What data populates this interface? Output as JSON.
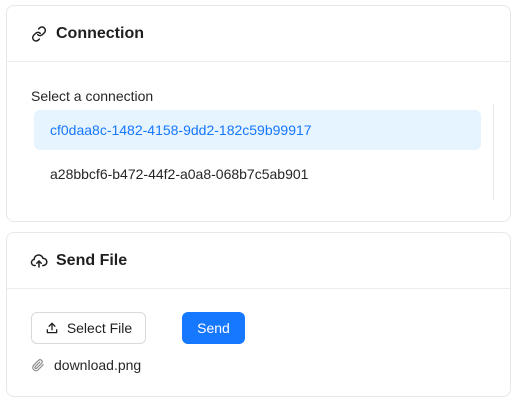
{
  "connection_card": {
    "title": "Connection",
    "title_icon": "link-icon",
    "select_label": "Select a connection",
    "connections": [
      {
        "id": "cf0daa8c-1482-4158-9dd2-182c59b99917",
        "selected": true
      },
      {
        "id": "a28bbcf6-b472-44f2-a0a8-068b7c5ab901",
        "selected": false
      }
    ]
  },
  "send_card": {
    "title": "Send File",
    "title_icon": "cloud-upload-icon",
    "select_file_label": "Select File",
    "select_file_icon": "upload-icon",
    "send_label": "Send",
    "file_icon": "paperclip-icon",
    "file_name": "download.png"
  },
  "colors": {
    "accent": "#1677ff",
    "selected_bg": "#e6f4ff",
    "border": "#e8e8e8"
  }
}
